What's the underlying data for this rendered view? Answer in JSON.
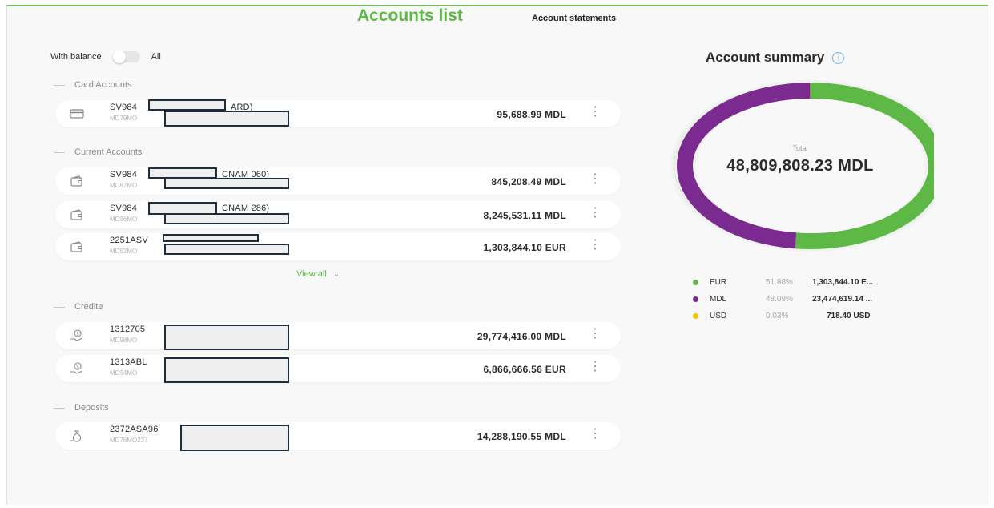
{
  "tabs": {
    "active": "Accounts list",
    "other": "Account statements"
  },
  "filter": {
    "with_balance": "With balance",
    "all": "All"
  },
  "sections": {
    "card": "Card Accounts",
    "current": "Current Accounts",
    "credit": "Credite",
    "deposits": "Deposits"
  },
  "accounts": [
    {
      "name": "SV984",
      "suffix": "ARD)",
      "sub": "MD79MO",
      "amount": "95,688.99 MDL"
    },
    {
      "name": "SV984",
      "suffix": "CNAM 060)",
      "sub": "MD87MO",
      "amount": "845,208.49 MDL"
    },
    {
      "name": "SV984",
      "suffix": "CNAM 286)",
      "sub": "MD96MO",
      "amount": "8,245,531.11 MDL"
    },
    {
      "name": "2251ASV",
      "suffix": "",
      "sub": "MD52MO",
      "amount": "1,303,844.10 EUR"
    },
    {
      "name": "1312705",
      "suffix": "",
      "sub": "MD98MO",
      "amount": "29,774,416.00 MDL"
    },
    {
      "name": "1313ABL",
      "suffix": "",
      "sub": "MD94MO",
      "amount": "6,866,666.56 EUR"
    },
    {
      "name": "2372ASA96",
      "suffix": "",
      "sub": "MD76MO237",
      "amount": "14,288,190.55 MDL"
    }
  ],
  "view_all": "View all",
  "summary": {
    "title": "Account summary",
    "total_label": "Total",
    "total_value": "48,809,808.23 MDL"
  },
  "legend": [
    {
      "code": "EUR",
      "pct": "51.88%",
      "amount": "1,303,844.10 E...",
      "color": "#5eb846",
      "share": 51.88
    },
    {
      "code": "MDL",
      "pct": "48.09%",
      "amount": "23,474,619.14 ...",
      "color": "#7b2a8f",
      "share": 48.09
    },
    {
      "code": "USD",
      "pct": "0.03%",
      "amount": "718.40 USD",
      "color": "#f2c500",
      "share": 0.03
    }
  ]
}
